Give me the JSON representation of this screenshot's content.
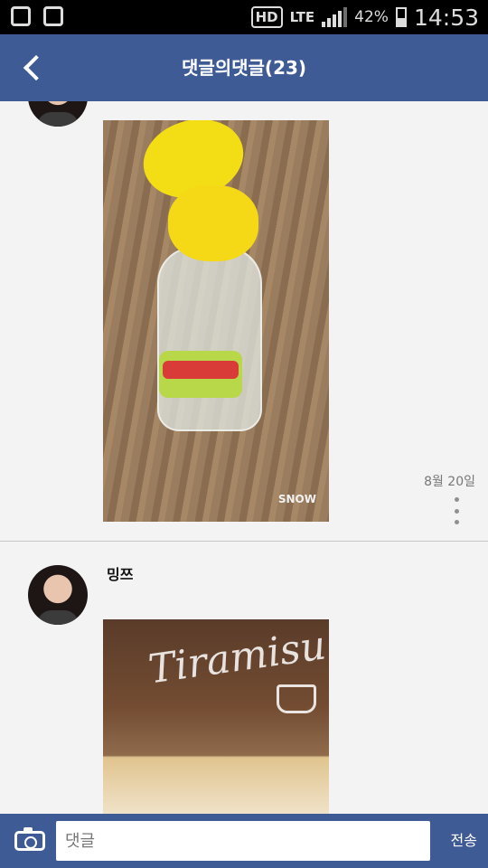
{
  "status_bar": {
    "network": "HD",
    "network_type": "LTE",
    "battery": "42%",
    "time": "14:53"
  },
  "header": {
    "title": "댓글의댓글(23)",
    "back_icon": "chevron-left-icon"
  },
  "comments": [
    {
      "image_watermark": "SNOW",
      "date": "8월 20일"
    },
    {
      "username": "밍쯔",
      "image_text": "Tiramisu"
    }
  ],
  "composer": {
    "camera_icon": "camera-icon",
    "placeholder": "댓글",
    "send_label": "전송"
  },
  "colors": {
    "header_bg": "#3f5b96",
    "page_bg": "#f3f3f3"
  }
}
